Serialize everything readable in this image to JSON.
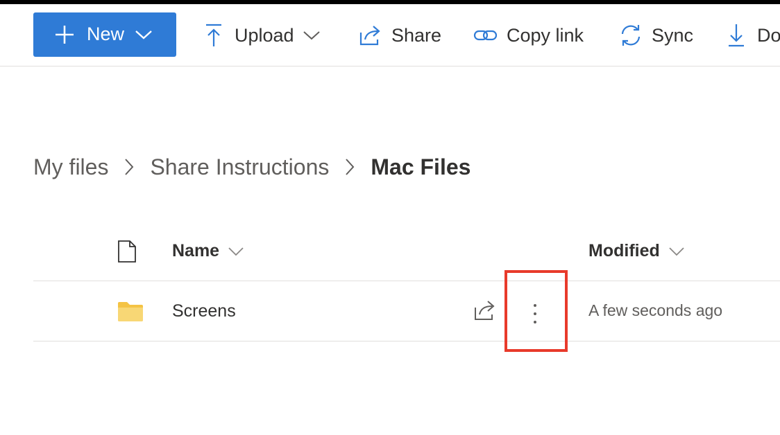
{
  "toolbar": {
    "new_label": "New",
    "upload_label": "Upload",
    "share_label": "Share",
    "copy_link_label": "Copy link",
    "sync_label": "Sync",
    "download_label": "Download"
  },
  "breadcrumb": {
    "items": [
      "My files",
      "Share Instructions"
    ],
    "current": "Mac Files"
  },
  "list": {
    "columns": {
      "name": "Name",
      "modified": "Modified"
    },
    "rows": [
      {
        "name": "Screens",
        "modified": "A few seconds ago",
        "type": "folder"
      }
    ]
  },
  "colors": {
    "accent": "#2f7bd6",
    "highlight": "#e83a2b",
    "folder": "#f8d775"
  },
  "icons": {
    "new": "plus-icon",
    "upload": "upload-arrow-icon",
    "share": "share-icon",
    "copy_link": "link-icon",
    "sync": "sync-icon",
    "download": "download-arrow-icon",
    "more": "more-vertical-icon"
  }
}
